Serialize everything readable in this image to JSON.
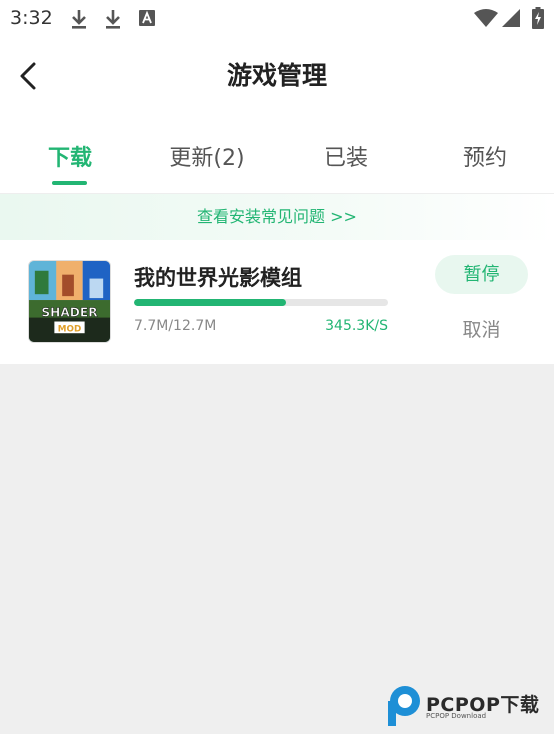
{
  "status_bar": {
    "time": "3:32",
    "left_icons": [
      "download-icon",
      "download-icon",
      "font-a-icon"
    ],
    "right_icons": [
      "wifi-icon",
      "signal-icon",
      "battery-charging-icon"
    ]
  },
  "header": {
    "title": "游戏管理",
    "back_icon": "chevron-left-icon"
  },
  "tabs": [
    {
      "label": "下载",
      "active": true
    },
    {
      "label": "更新(2)",
      "active": false
    },
    {
      "label": "已装",
      "active": false
    },
    {
      "label": "预约",
      "active": false
    }
  ],
  "faq_banner": {
    "text": "查看安装常见问题 >>"
  },
  "download_item": {
    "name": "我的世界光影模组",
    "icon_line1": "SHADER",
    "icon_line2": "MOD",
    "size": "7.7M/12.7M",
    "speed": "345.3K/S",
    "progress": 0.6,
    "pause_label": "暂停",
    "cancel_label": "取消"
  },
  "watermark": {
    "brand": "PCPOP下载",
    "sub": "PCPOP Download"
  },
  "colors": {
    "accent": "#22b573",
    "accent_light": "#e8f7ef",
    "background": "#efefef"
  }
}
